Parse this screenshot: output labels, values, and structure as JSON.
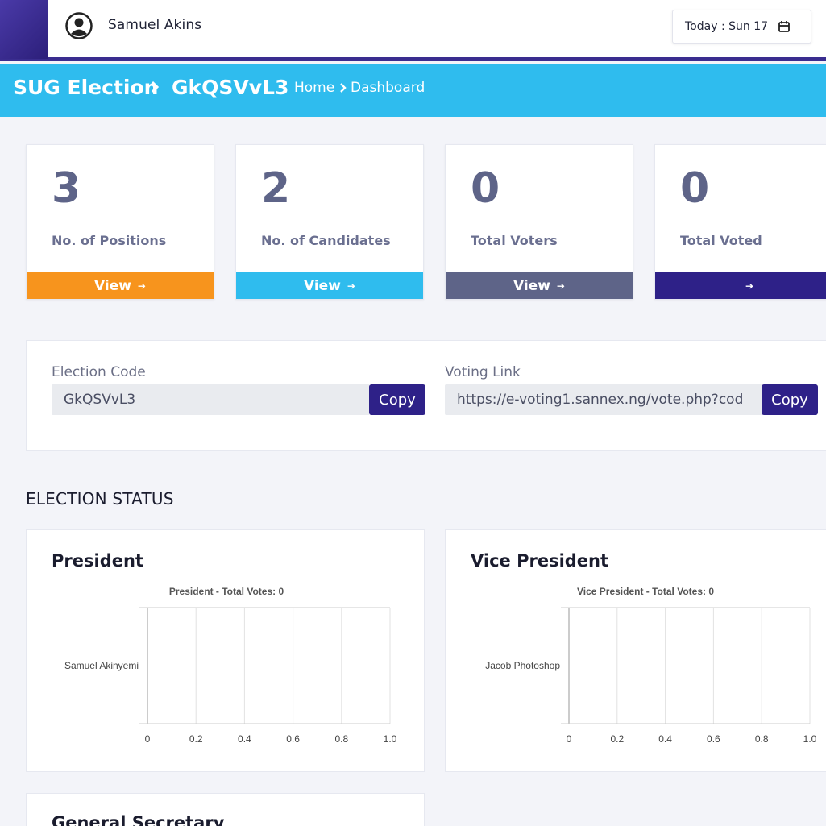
{
  "topbar": {
    "user_name": "Samuel Akins",
    "date_label": "Today : Sun 17"
  },
  "header": {
    "title": "SUG Election",
    "code": "GkQSVvL3",
    "breadcrumb_home": "Home",
    "breadcrumb_current": "Dashboard"
  },
  "stats": [
    {
      "value": "3",
      "label": "No. of Positions",
      "button": "View",
      "color": "#f7941d"
    },
    {
      "value": "2",
      "label": "No. of Candidates",
      "button": "View",
      "color": "#2fbcee"
    },
    {
      "value": "0",
      "label": "Total Voters",
      "button": "View",
      "color": "#5e6488"
    },
    {
      "value": "0",
      "label": "Total Voted",
      "button": "",
      "color": "#2e2188"
    }
  ],
  "links": {
    "election_code_label": "Election Code",
    "election_code_value": "GkQSVvL3",
    "voting_link_label": "Voting Link",
    "voting_link_value": "https://e-voting1.sannex.ng/vote.php?cod",
    "copy_label": "Copy"
  },
  "section_title": "ELECTION STATUS",
  "positions": {
    "president": "President",
    "vice_president": "Vice President",
    "general_secretary": "General Secretary"
  },
  "chart_data": [
    {
      "type": "bar",
      "orientation": "horizontal",
      "title": "President - Total Votes: 0",
      "categories": [
        "Samuel Akinyemi"
      ],
      "values": [
        0
      ],
      "xlim": [
        0,
        1
      ],
      "xticks": [
        "0",
        "0.2",
        "0.4",
        "0.6",
        "0.8",
        "1.0"
      ],
      "grid": true
    },
    {
      "type": "bar",
      "orientation": "horizontal",
      "title": "Vice President - Total Votes: 0",
      "categories": [
        "Jacob Photoshop"
      ],
      "values": [
        0
      ],
      "xlim": [
        0,
        1
      ],
      "xticks": [
        "0",
        "0.2",
        "0.4",
        "0.6",
        "0.8",
        "1.0"
      ],
      "grid": true
    }
  ]
}
